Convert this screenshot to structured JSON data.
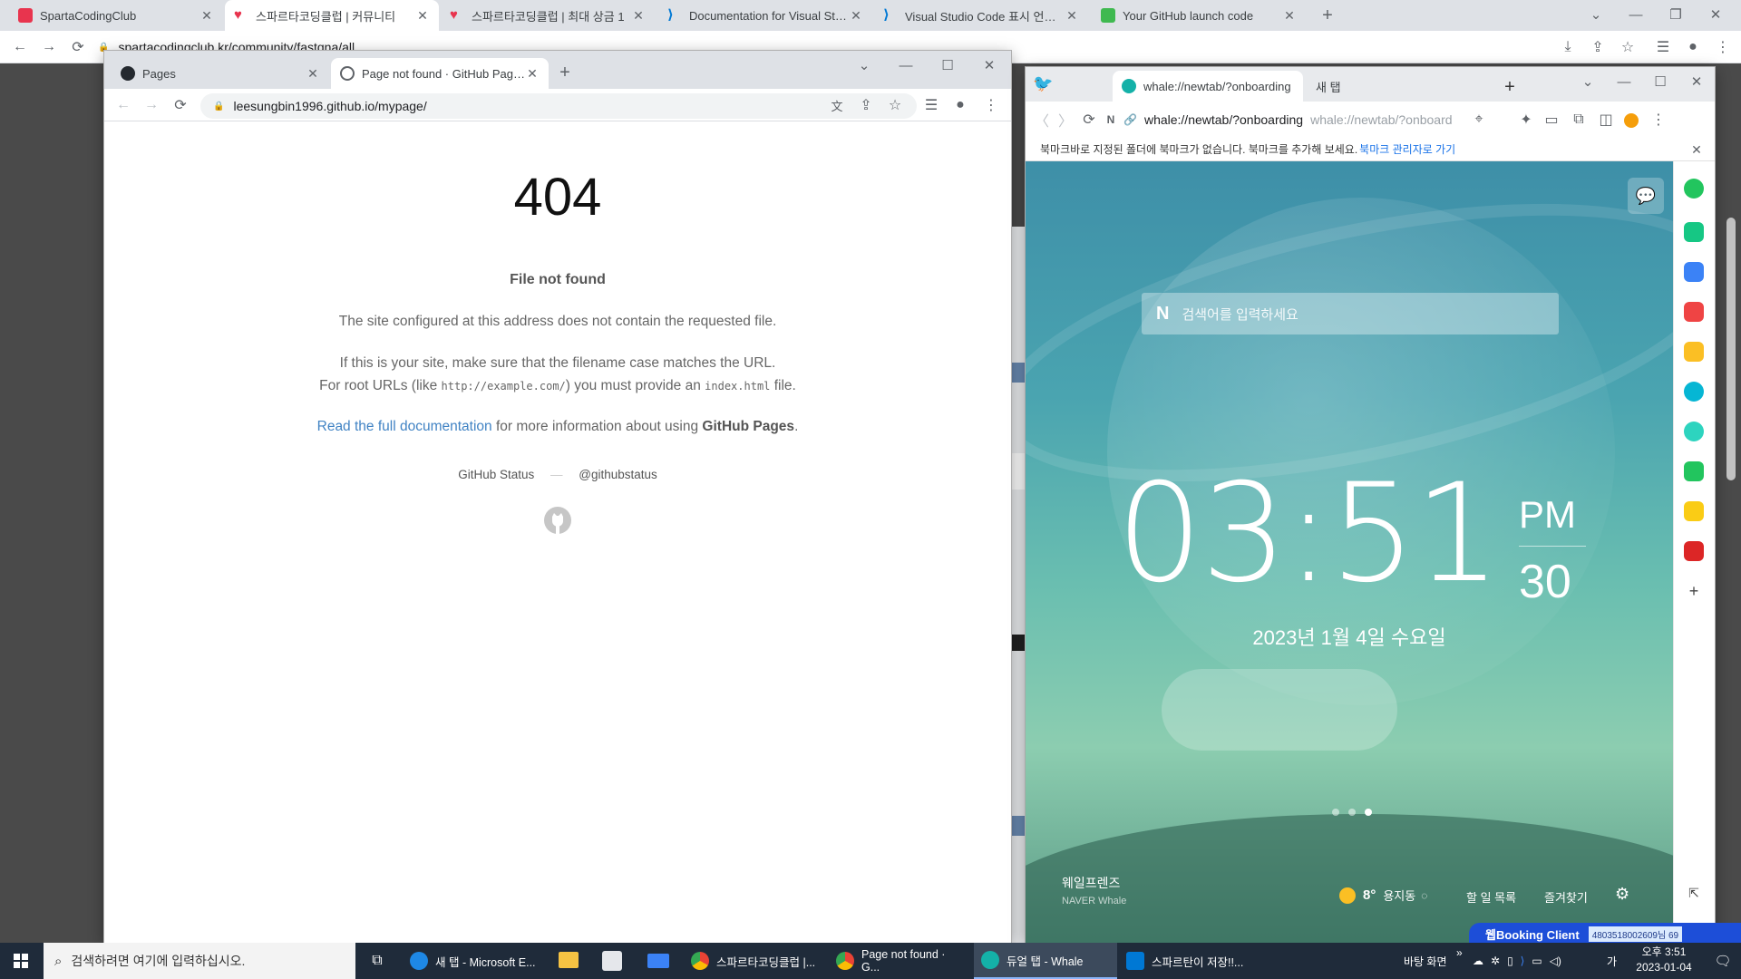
{
  "outer_browser": {
    "tabs": [
      {
        "label": "SpartaCodingClub",
        "color": "#e8344e"
      },
      {
        "label": "스파르타코딩클럽 | 커뮤니티",
        "color": "#e8344e"
      },
      {
        "label": "스파르타코딩클럽 | 최대 상금 1",
        "color": "#e8344e"
      },
      {
        "label": "Documentation for Visual Studi",
        "color": "#0078d4"
      },
      {
        "label": "Visual Studio Code 표시 언어(동",
        "color": "#0078d4"
      },
      {
        "label": "Your GitHub launch code",
        "color": "#3fb950"
      }
    ],
    "url": "spartacodingclub.kr/community/fastqna/all"
  },
  "github_window": {
    "tabs": [
      {
        "label": "Pages"
      },
      {
        "label": "Page not found · GitHub Pages"
      }
    ],
    "url": "leesungbin1996.github.io/mypage/",
    "page": {
      "code": "404",
      "title": "File not found",
      "p1": "The site configured at this address does not contain the requested file.",
      "p2": "If this is your site, make sure that the filename case matches the URL.",
      "p3_pre": "For root URLs (like ",
      "p3_code1": "http://example.com/",
      "p3_mid": ") you must provide an ",
      "p3_code2": "index.html",
      "p3_post": " file.",
      "doc_link": "Read the full documentation",
      "doc_mid": " for more information about using ",
      "doc_strong": "GitHub Pages",
      "doc_end": ".",
      "footer_status": "GitHub Status",
      "footer_dash": "—",
      "footer_handle": "@githubstatus"
    }
  },
  "whale_window": {
    "tabs": [
      {
        "label": "whale://newtab/?onboarding"
      },
      {
        "label": "새 탭"
      }
    ],
    "url": "whale://newtab/?onboarding",
    "url_ghost": "whale://newtab/?onboard",
    "bookmark_bar_msg": "북마크바로 지정된 폴더에 북마크가 없습니다. 북마크를 추가해 보세요.",
    "bookmark_bar_link": "북마크 관리자로 가기",
    "search_placeholder": "검색어를 입력하세요",
    "search_logo": "N",
    "clock_time": "03:51",
    "clock_ampm": "PM",
    "clock_seconds": "30",
    "clock_date": "2023년 1월 4일 수요일",
    "brand_title": "웨일프렌즈",
    "brand_sub": "NAVER Whale",
    "weather_temp": "8°",
    "weather_loc": "용지동",
    "todo": "할 일 목록",
    "favorites": "즐겨찾기",
    "booking_label": "웹Booking Client",
    "booking_id": "4803518002609님 69"
  },
  "taskbar": {
    "search_placeholder": "검색하려면 여기에 입력하십시오.",
    "items": [
      {
        "label": "새 탭 - Microsoft E..."
      },
      {
        "label": "스파르타코딩클럽 |..."
      },
      {
        "label": "Page not found · G..."
      },
      {
        "label": "듀얼 탭 - Whale"
      },
      {
        "label": "스파르탄이 저장!!..."
      }
    ],
    "desktop_label": "바탕 화면",
    "ime": "가",
    "time": "오후 3:51",
    "date": "2023-01-04"
  }
}
